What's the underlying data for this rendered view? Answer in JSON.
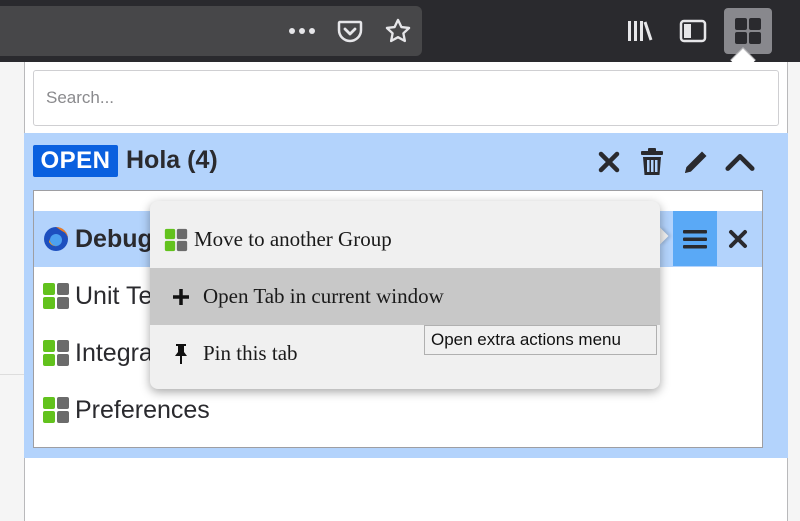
{
  "toolbar": {
    "icons": [
      "more-icon",
      "pocket-icon",
      "star-icon",
      "library-icon",
      "sidebar-icon",
      "panorama-tab-groups-icon"
    ]
  },
  "search": {
    "placeholder": "Search..."
  },
  "group": {
    "badge": "OPEN",
    "title": "Hola (4)",
    "actions": [
      "close-icon",
      "trash-icon",
      "pencil-icon",
      "collapse-chevron-icon"
    ]
  },
  "tabs": [
    {
      "label": "Debugging",
      "icon": "firefox-icon",
      "active": true
    },
    {
      "label": "Unit Tests",
      "icon": "tab-groups-icon"
    },
    {
      "label": "Integration Tests",
      "icon": "tab-groups-icon"
    },
    {
      "label": "Preferences",
      "icon": "tab-groups-icon"
    }
  ],
  "context_menu": {
    "items": [
      {
        "label": "Move to another Group",
        "icon": "tab-groups-icon"
      },
      {
        "label": "Open Tab in current window",
        "icon": "plus-icon"
      },
      {
        "label": "Pin this tab",
        "icon": "pin-icon"
      }
    ]
  },
  "tooltip": {
    "text": "Open extra actions menu"
  },
  "colors": {
    "accent": "#0a60df",
    "group_bg": "#b3d3fc",
    "menu_button": "#5aa9f6",
    "icon_green": "#62c21d",
    "icon_gray": "#6b6b6b"
  }
}
